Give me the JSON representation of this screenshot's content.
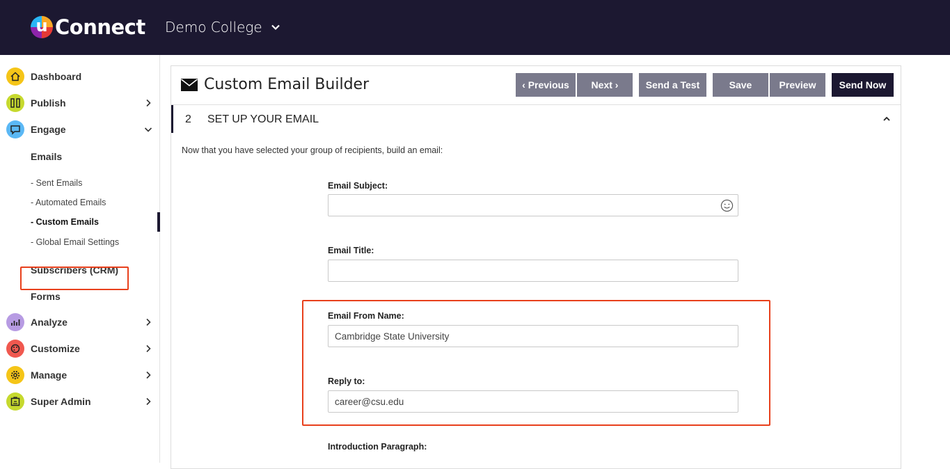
{
  "header": {
    "logo_letter": "u",
    "logo_text": "Connect",
    "college": "Demo College"
  },
  "sidebar": {
    "items": [
      {
        "label": "Dashboard",
        "icon": "home-icon",
        "color": "#f5c518"
      },
      {
        "label": "Publish",
        "icon": "columns-icon",
        "color": "#c6d92e"
      },
      {
        "label": "Engage",
        "icon": "chat-icon",
        "color": "#5bb8f5"
      },
      {
        "label": "Analyze",
        "icon": "chart-icon",
        "color": "#b79be3"
      },
      {
        "label": "Customize",
        "icon": "palette-icon",
        "color": "#f0584f"
      },
      {
        "label": "Manage",
        "icon": "gear-icon",
        "color": "#f5c518"
      },
      {
        "label": "Super Admin",
        "icon": "badge-icon",
        "color": "#c6d92e"
      }
    ],
    "engage_sub": {
      "emails": "Emails",
      "sent": "- Sent Emails",
      "automated": "- Automated Emails",
      "custom": "- Custom Emails",
      "global": "- Global Email Settings",
      "subscribers": "Subscribers (CRM)",
      "forms": "Forms"
    }
  },
  "main": {
    "title": "Custom Email Builder",
    "buttons": {
      "previous": "‹ Previous",
      "next": "Next ›",
      "send_test": "Send a Test",
      "save": "Save",
      "preview": "Preview",
      "send_now": "Send Now"
    },
    "step": {
      "number": "2",
      "title": "SET UP YOUR EMAIL"
    },
    "intro": "Now that you have selected your group of recipients, build an email:",
    "fields": {
      "subject_label": "Email Subject:",
      "subject_value": "",
      "title_label": "Email Title:",
      "title_value": "",
      "from_label": "Email From Name:",
      "from_value": "Cambridge State University",
      "reply_label": "Reply to:",
      "reply_value": "career@csu.edu",
      "intro_label": "Introduction Paragraph:"
    }
  },
  "colors": {
    "header_bg": "#1c1831",
    "button_gray": "#7a7a8c",
    "highlight": "#e8401c"
  }
}
